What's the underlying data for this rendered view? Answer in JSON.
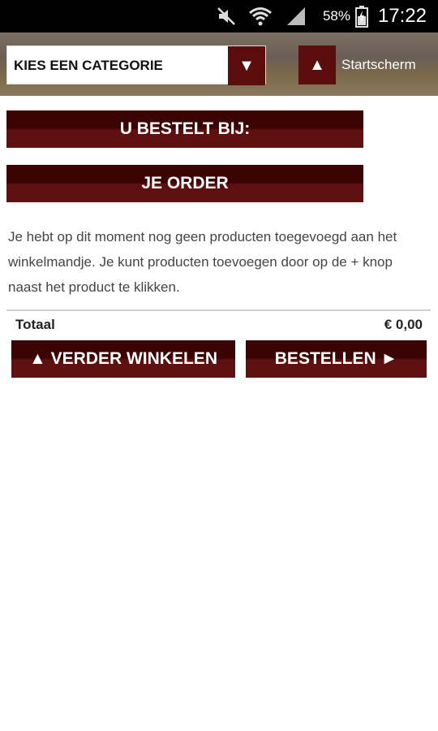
{
  "status_bar": {
    "battery": "58%",
    "time": "17:22",
    "icons": [
      "mute-icon",
      "wifi-icon",
      "signal-icon",
      "battery-icon"
    ]
  },
  "header": {
    "category_select": "KIES EEN CATEGORIE",
    "dropdown_icon": "▼",
    "home_icon": "▲",
    "home_label": "Startscherm"
  },
  "sections": {
    "order_from": "U BESTELT BIJ:",
    "your_order": "JE ORDER"
  },
  "cart": {
    "empty_message": "Je hebt op dit moment nog geen producten toegevoegd aan het winkelmandje. Je kunt producten toevoegen door op de + knop naast het product te klikken.",
    "total_label": "Totaal",
    "total_value": "€ 0,00"
  },
  "actions": {
    "continue_shopping": "▲ VERDER WINKELEN",
    "order": "BESTELLEN ►"
  },
  "colors": {
    "brand": "#5b0d0d",
    "brand_dark": "#3b0404"
  }
}
